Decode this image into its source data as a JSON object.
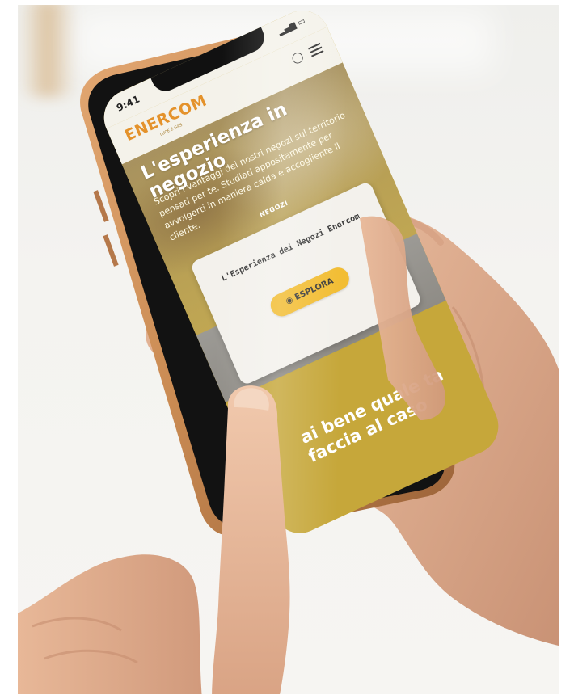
{
  "status_bar": {
    "time": "9:41",
    "signal_icon": "signal-bars-icon",
    "battery_icon": "battery-icon"
  },
  "header": {
    "logo_text": "ENERCOM",
    "logo_subtext": "LUCE E GAS",
    "user_icon": "user-icon",
    "menu_icon": "hamburger-menu-icon"
  },
  "hero": {
    "title": "L'esperienza in negozio",
    "body": "Scopri i vantaggi dei nostri negozi sul territorio pensati per te. Studiati appositamente per avvolgerti in maniera calda e accogliente il cliente."
  },
  "card": {
    "tag": "NEGOZI",
    "title": "L'Esperienza dei Negozi Enercom",
    "button_label": "ESPLORA",
    "button_icon": "eye-icon"
  },
  "lower_section": {
    "text": "ai bene quale ta faccia al caso"
  },
  "colors": {
    "brand_orange": "#e4922b",
    "yellow": "#c6a73a",
    "button_yellow": "#f2bd33",
    "blue": "#3f84c4",
    "phone_frame": "#c98a52"
  }
}
